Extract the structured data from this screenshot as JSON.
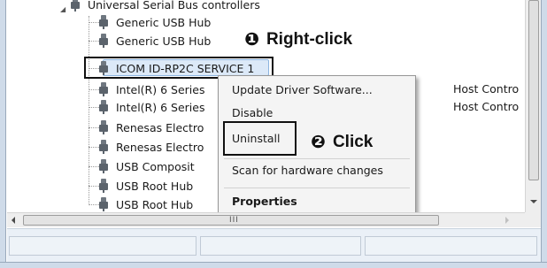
{
  "tree": {
    "root_label": "Universal Serial Bus controllers",
    "items": [
      {
        "label": "Generic USB Hub"
      },
      {
        "label": "Generic USB Hub"
      },
      {
        "label": "ICOM ID-RP2C SERVICE 1"
      },
      {
        "label": "Intel(R) 6 Series"
      },
      {
        "label": "Intel(R) 6 Series"
      },
      {
        "label": "Renesas Electro"
      },
      {
        "label": "Renesas Electro"
      },
      {
        "label": "USB Composit"
      },
      {
        "label": "USB Root Hub"
      },
      {
        "label": "USB Root Hub"
      }
    ],
    "overflow_text_1": "Host Contro",
    "overflow_text_2": "Host Contro"
  },
  "context_menu": {
    "items": [
      {
        "label": "Update Driver Software..."
      },
      {
        "label": "Disable"
      },
      {
        "label": "Uninstall"
      },
      {
        "label": "Scan for hardware changes"
      },
      {
        "label": "Properties"
      }
    ]
  },
  "annotations": {
    "step1_number": "❶",
    "step1_text": "Right-click",
    "step2_number": "❷",
    "step2_text": "Click"
  },
  "scrollbar": {
    "grip": "III"
  }
}
